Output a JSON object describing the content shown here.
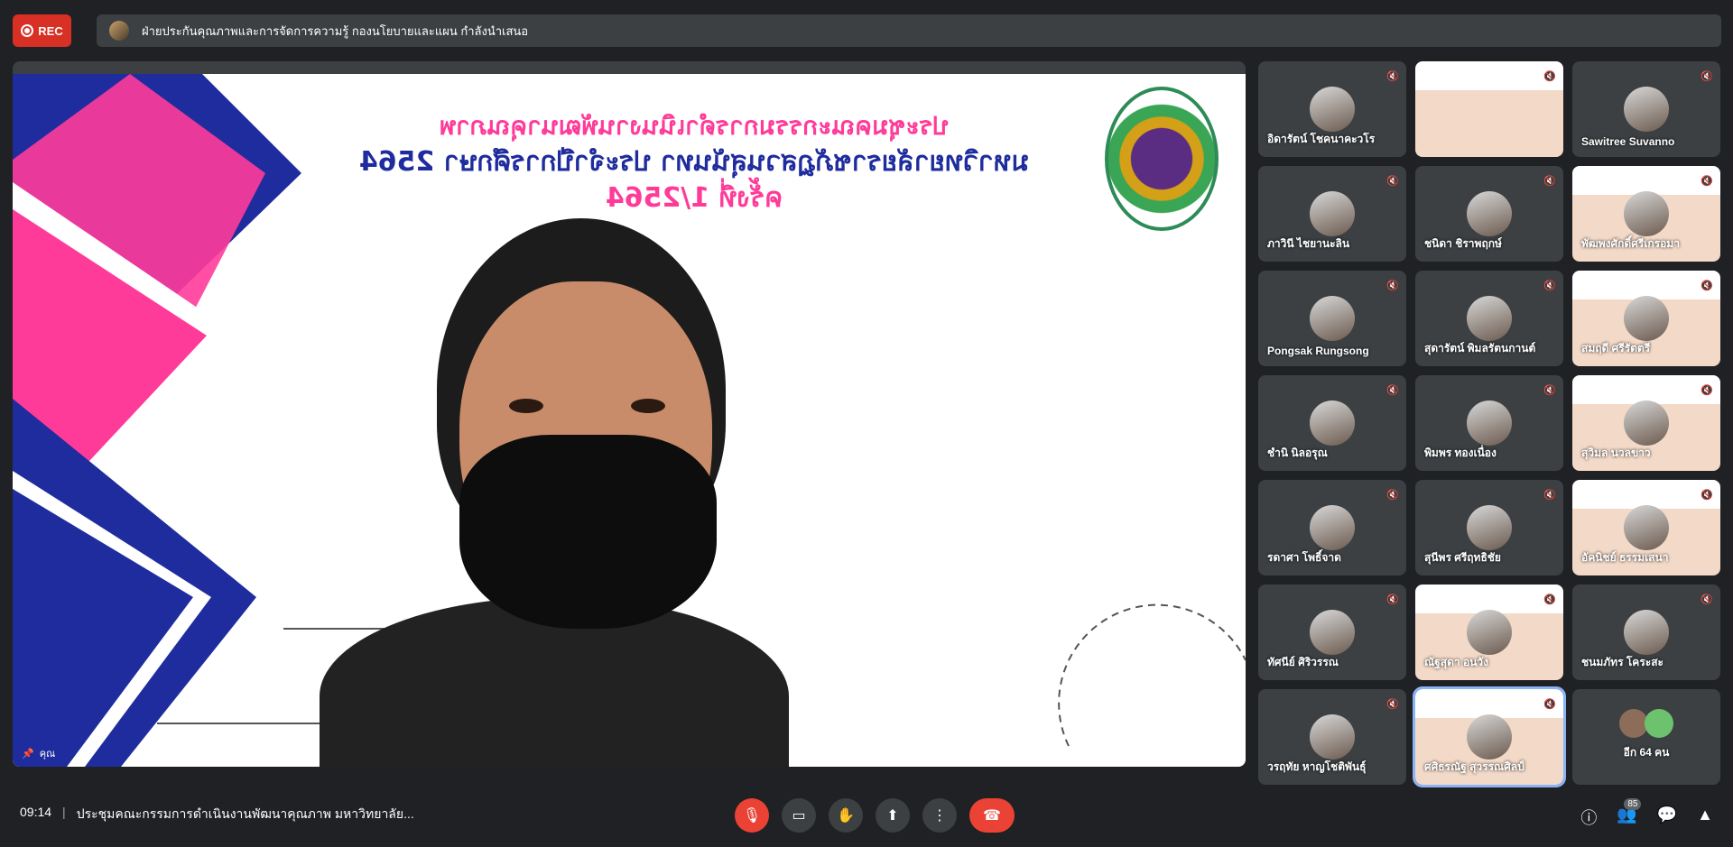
{
  "recording": {
    "label": "REC"
  },
  "presenter": {
    "text": "ฝ่ายประกันคุณภาพและการจัดการความรู้ กองนโยบายและแผน กำลังนำเสนอ"
  },
  "slide": {
    "line1": "ประชุมคณะกรรมการดำเนินงานพัฒนาคุณภาพ",
    "line2": "มหาวิทยาลัยราชภัฏสวนสุนันทา ประจำปีการศึกษา 2564",
    "line3": "ครั้งที่ 1/2564"
  },
  "pinned": {
    "label": "คุณ"
  },
  "participants": [
    {
      "name": "อิดารัตน์ โชคนาคะวโร"
    },
    {
      "name": ""
    },
    {
      "name": "Sawitree Suvanno"
    },
    {
      "name": "ภาวินี ไชยานะลิน"
    },
    {
      "name": "ชนิดา ชิราพฤกษ์"
    },
    {
      "name": "พัฒพงศักดิ์ศรีเกรอมา"
    },
    {
      "name": "Pongsak Rungsong"
    },
    {
      "name": "สุดารัตน์ พิมลรัตนกานต์"
    },
    {
      "name": "สมฤดี ศรีรัตตรี"
    },
    {
      "name": "ชำนิ นิลอรุณ"
    },
    {
      "name": "พิมพร ทองเนื่อง"
    },
    {
      "name": "สุวิมล นวลขาว"
    },
    {
      "name": "รดาศา โพธิ์จาด"
    },
    {
      "name": "สุนีพร ศรีฤทธิชัย"
    },
    {
      "name": "อัคนิชย์ ธรรมเสนา"
    },
    {
      "name": "ทัศนีย์ ศิริวรรณ"
    },
    {
      "name": "ณัฐสุดา อนวัง"
    },
    {
      "name": "ชนมภัทร โคระสะ"
    },
    {
      "name": "วรฤทัย หาญโชติพันธุ์"
    },
    {
      "name": "ศศิธรณัฐ สุวรรณศิลป์"
    },
    {
      "name": "อีก 64 คน"
    }
  ],
  "meeting": {
    "time": "09:14",
    "divider": "|",
    "title": "ประชุมคณะกรรมการดำเนินงานพัฒนาคุณภาพ มหาวิทยาลัย..."
  },
  "people_count": "85",
  "colors": {
    "accent_pink": "#ff3b9a",
    "accent_blue": "#1f2c9e",
    "danger": "#ea4335"
  }
}
